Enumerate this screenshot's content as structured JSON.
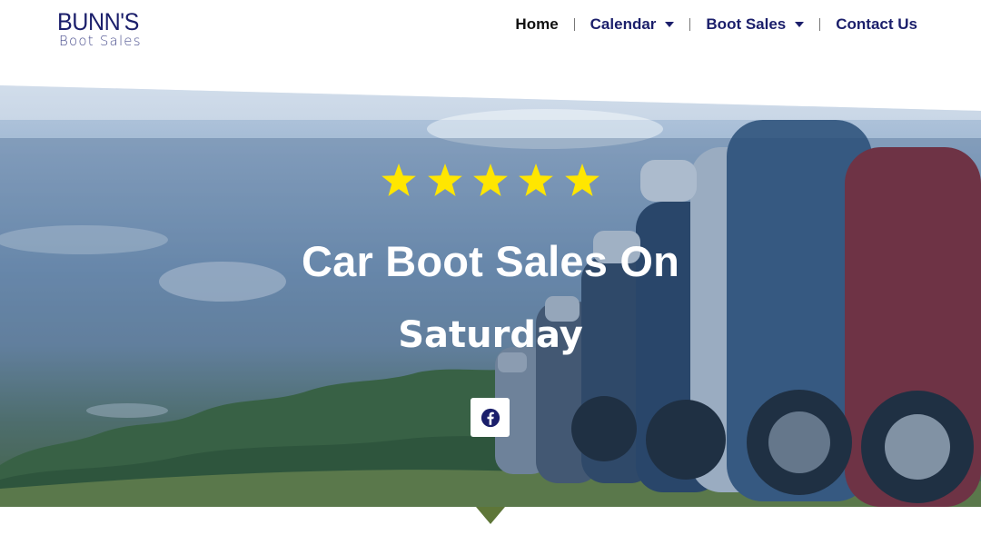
{
  "header": {
    "logo": {
      "main": "BUNN'S",
      "sub": "Boot Sales"
    },
    "nav": [
      {
        "label": "Home",
        "active": true,
        "has_dropdown": false
      },
      {
        "label": "Calendar",
        "active": false,
        "has_dropdown": true
      },
      {
        "label": "Boot Sales",
        "active": false,
        "has_dropdown": true
      },
      {
        "label": "Contact Us",
        "active": false,
        "has_dropdown": false
      }
    ]
  },
  "hero": {
    "rating_stars": 5,
    "title": "Car Boot Sales On",
    "subtitle": "Saturday",
    "social": {
      "icon": "facebook-icon"
    }
  },
  "colors": {
    "brand_navy": "#1b1f6b",
    "star_yellow": "#ffe600",
    "hero_text": "#ffffff",
    "grass_green": "#5e7638"
  }
}
